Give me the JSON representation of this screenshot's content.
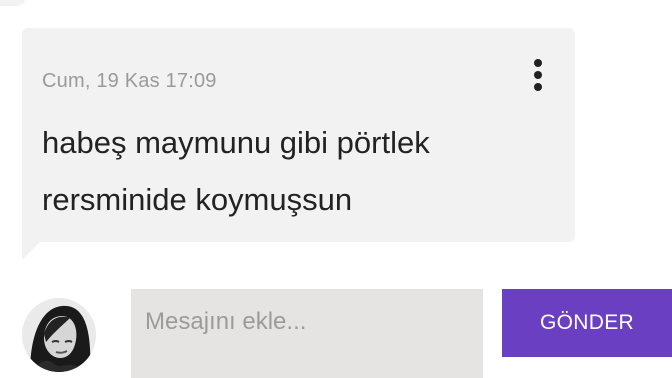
{
  "message": {
    "timestamp": "Cum, 19 Kas 17:09",
    "text_line1": "habeş maymunu gibi pörtlek",
    "text_line2": "rersminide koymuşsun",
    "more_icon": "more-vertical-icon"
  },
  "composer": {
    "placeholder": "Mesajını ekle...",
    "value": "",
    "send_label": "GÖNDER"
  },
  "colors": {
    "bubble_bg": "#f2f2f2",
    "accent": "#6b3fc2",
    "input_bg": "#e5e4e2",
    "timestamp": "#9a9a9a",
    "text": "#222222"
  }
}
